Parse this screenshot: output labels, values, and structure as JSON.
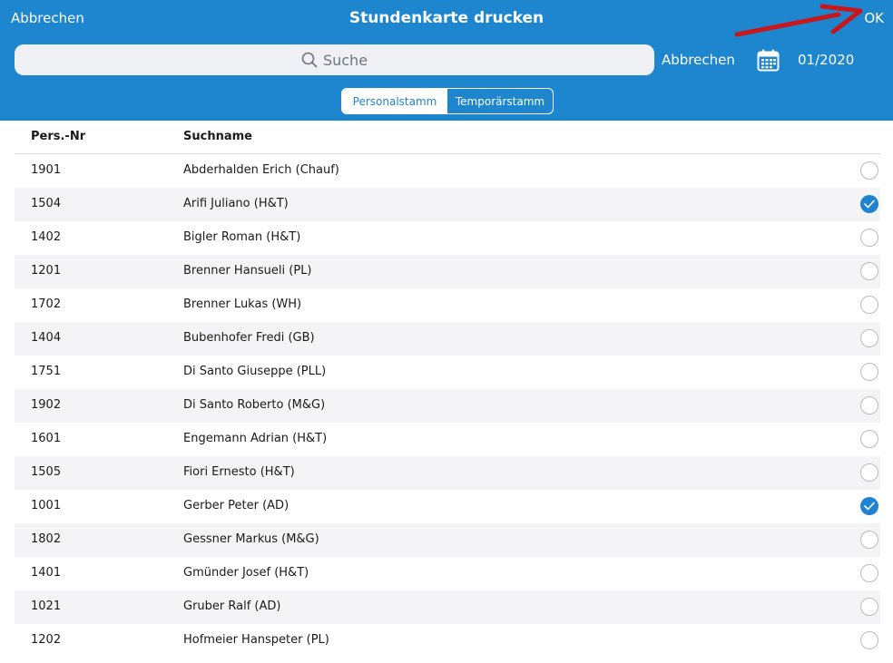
{
  "header": {
    "cancel_label": "Abbrechen",
    "title": "Stundenkarte drucken",
    "ok_label": "OK"
  },
  "search": {
    "placeholder": "Suche",
    "cancel_label": "Abbrechen",
    "period": "01/2020"
  },
  "segments": {
    "active": "Personalstamm",
    "inactive": "Temporärstamm"
  },
  "table": {
    "columns": [
      "Pers.-Nr",
      "Suchname"
    ],
    "rows": [
      {
        "nr": "1901",
        "name": "Abderhalden Erich (Chauf)",
        "selected": false
      },
      {
        "nr": "1504",
        "name": "Arifi Juliano (H&T)",
        "selected": true
      },
      {
        "nr": "1402",
        "name": "Bigler Roman (H&T)",
        "selected": false
      },
      {
        "nr": "1201",
        "name": "Brenner Hansueli (PL)",
        "selected": false
      },
      {
        "nr": "1702",
        "name": "Brenner Lukas (WH)",
        "selected": false
      },
      {
        "nr": "1404",
        "name": "Bubenhofer Fredi (GB)",
        "selected": false
      },
      {
        "nr": "1751",
        "name": "Di Santo Giuseppe (PLL)",
        "selected": false
      },
      {
        "nr": "1902",
        "name": "Di Santo Roberto (M&G)",
        "selected": false
      },
      {
        "nr": "1601",
        "name": "Engemann Adrian (H&T)",
        "selected": false
      },
      {
        "nr": "1505",
        "name": "Fiori Ernesto (H&T)",
        "selected": false
      },
      {
        "nr": "1001",
        "name": "Gerber Peter (AD)",
        "selected": true
      },
      {
        "nr": "1802",
        "name": "Gessner Markus (M&G)",
        "selected": false
      },
      {
        "nr": "1401",
        "name": "Gmünder Josef (H&T)",
        "selected": false
      },
      {
        "nr": "1021",
        "name": "Gruber Ralf (AD)",
        "selected": false
      },
      {
        "nr": "1202",
        "name": "Hofmeier Hanspeter (PL)",
        "selected": false
      }
    ]
  },
  "icons": {
    "search": "search-icon",
    "calendar": "calendar-icon",
    "annotation": "red-arrow-icon",
    "check": "checkmark-icon"
  },
  "colors": {
    "header_bg": "#1e85cf",
    "accent": "#1f83d1",
    "annotation_arrow": "#c8161d"
  }
}
